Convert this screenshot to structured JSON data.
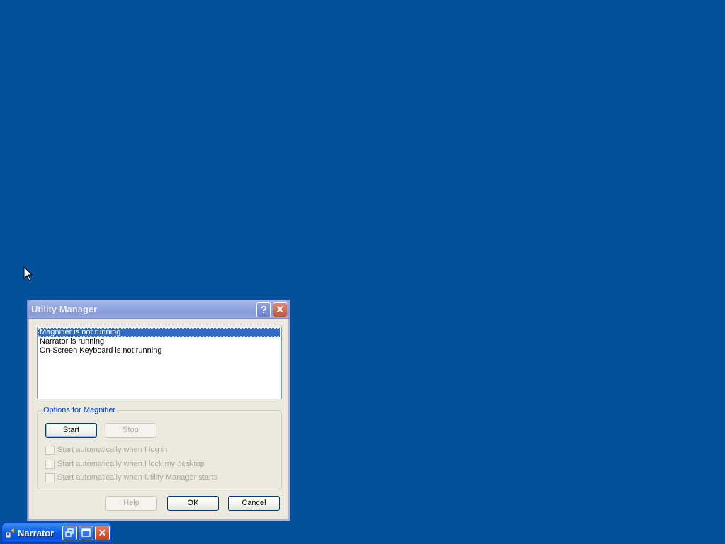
{
  "dialog": {
    "title": "Utility Manager",
    "help_button_glyph": "?",
    "close_button_glyph": "✕",
    "list_items": [
      {
        "label": "Magnifier is not running",
        "selected": true
      },
      {
        "label": "Narrator is running",
        "selected": false
      },
      {
        "label": "On-Screen Keyboard is not running",
        "selected": false
      }
    ],
    "options_group": {
      "legend": "Options for Magnifier",
      "start_label": "Start",
      "stop_label": "Stop",
      "checkboxes": [
        {
          "label": "Start automatically when I log in",
          "checked": false,
          "enabled": false
        },
        {
          "label": "Start automatically when I lock my desktop",
          "checked": false,
          "enabled": false
        },
        {
          "label": "Start automatically when Utility Manager starts",
          "checked": false,
          "enabled": false
        }
      ]
    },
    "help_label": "Help",
    "ok_label": "OK",
    "cancel_label": "Cancel"
  },
  "narrator_window": {
    "title": "Narrator",
    "close_glyph": "✕"
  },
  "colors": {
    "desktop": "#00509b",
    "selection": "#316ac5",
    "group_legend": "#0046d5"
  }
}
